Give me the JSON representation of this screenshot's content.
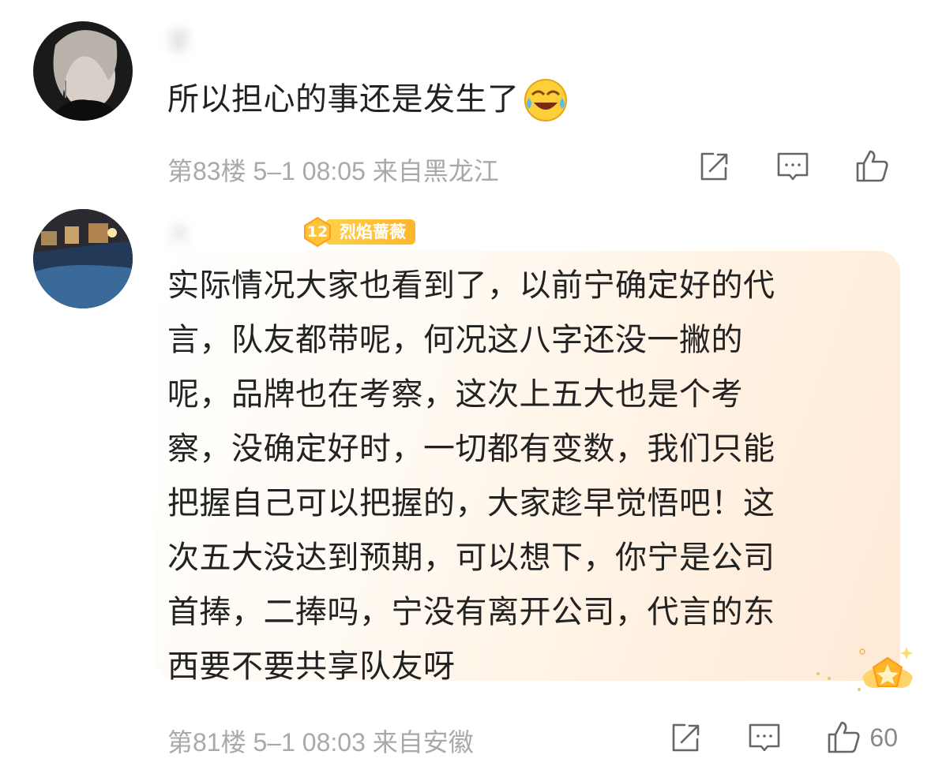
{
  "comments": [
    {
      "username": "蒙",
      "text": "所以担心的事还是发生了",
      "emoji": "laugh-cry-emoji",
      "floor": "第83楼",
      "time": "5–1 08:05",
      "location": "来自黑龙江",
      "likes": ""
    },
    {
      "username": "大",
      "badge_level": "12",
      "badge_name": "烈焰蔷薇",
      "text_lines": [
        "实际情况大家也看到了，以前宁确定好的代",
        "言，队友都带呢，何况这八字还没一撇的",
        "呢，品牌也在考察，这次上五大也是个考",
        "察，没确定好时，一切都有变数，我们只能",
        "把握自己可以把握的，大家趁早觉悟吧！这",
        "次五大没达到预期，可以想下，你宁是公司",
        "首捧，二捧吗，宁没有离开公司，代言的东",
        "西要不要共享队友呀"
      ],
      "floor": "第81楼",
      "time": "5–1 08:03",
      "location": "来自安徽",
      "likes": "60"
    }
  ],
  "icons": {
    "share": "share-icon",
    "comment": "comment-icon",
    "like": "thumbs-up-icon"
  },
  "colors": {
    "meta_text": "#a9a9a9",
    "badge": "#ffc238",
    "bubble_tint": "#fff1e2"
  }
}
